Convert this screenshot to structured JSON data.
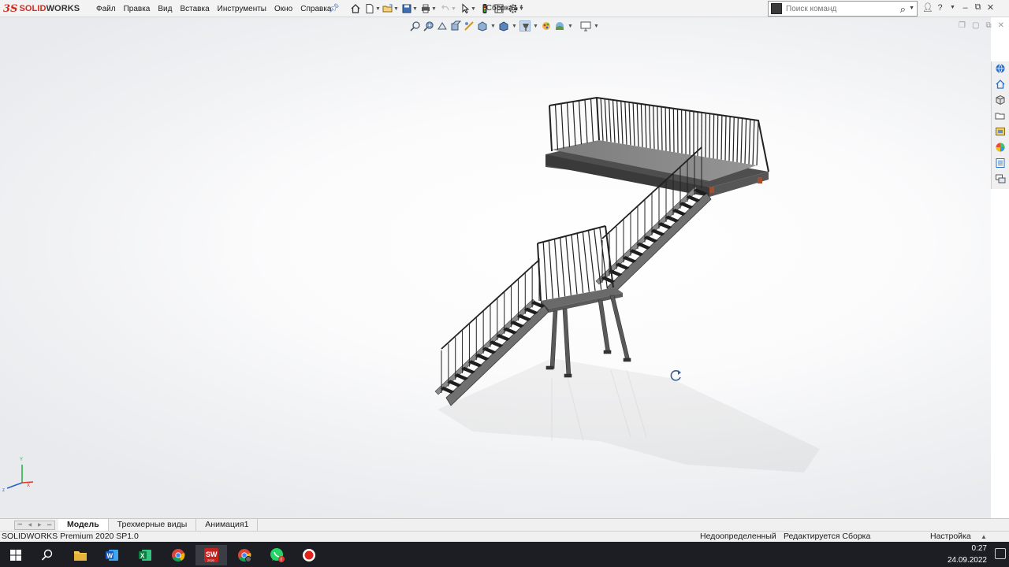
{
  "app": {
    "logo_prefix": "3S",
    "logo_brand": "SOLID",
    "logo_brand_suffix": "WORKS",
    "document_title": "Сборка1 *"
  },
  "menu": {
    "items": [
      "Файл",
      "Правка",
      "Вид",
      "Вставка",
      "Инструменты",
      "Окно",
      "Справка"
    ]
  },
  "search": {
    "placeholder": "Поиск команд"
  },
  "tabs": {
    "items": [
      {
        "label": "Модель",
        "active": true
      },
      {
        "label": "Трехмерные виды",
        "active": false
      },
      {
        "label": "Анимация1",
        "active": false
      }
    ]
  },
  "status": {
    "product": "SOLIDWORKS Premium 2020 SP1.0",
    "definition": "Недоопределенный",
    "editing": "Редактируется Сборка",
    "units": "Настройка"
  },
  "taskbar": {
    "time": "0:27",
    "date": "24.09.2022",
    "sw_badge": "2020"
  },
  "triad": {
    "y_label": "Y",
    "x_label": "X"
  },
  "colors": {
    "brand": "#d52b1e",
    "accent_blue": "#2a6fc9",
    "taskbar_bg": "#1c1e24"
  }
}
